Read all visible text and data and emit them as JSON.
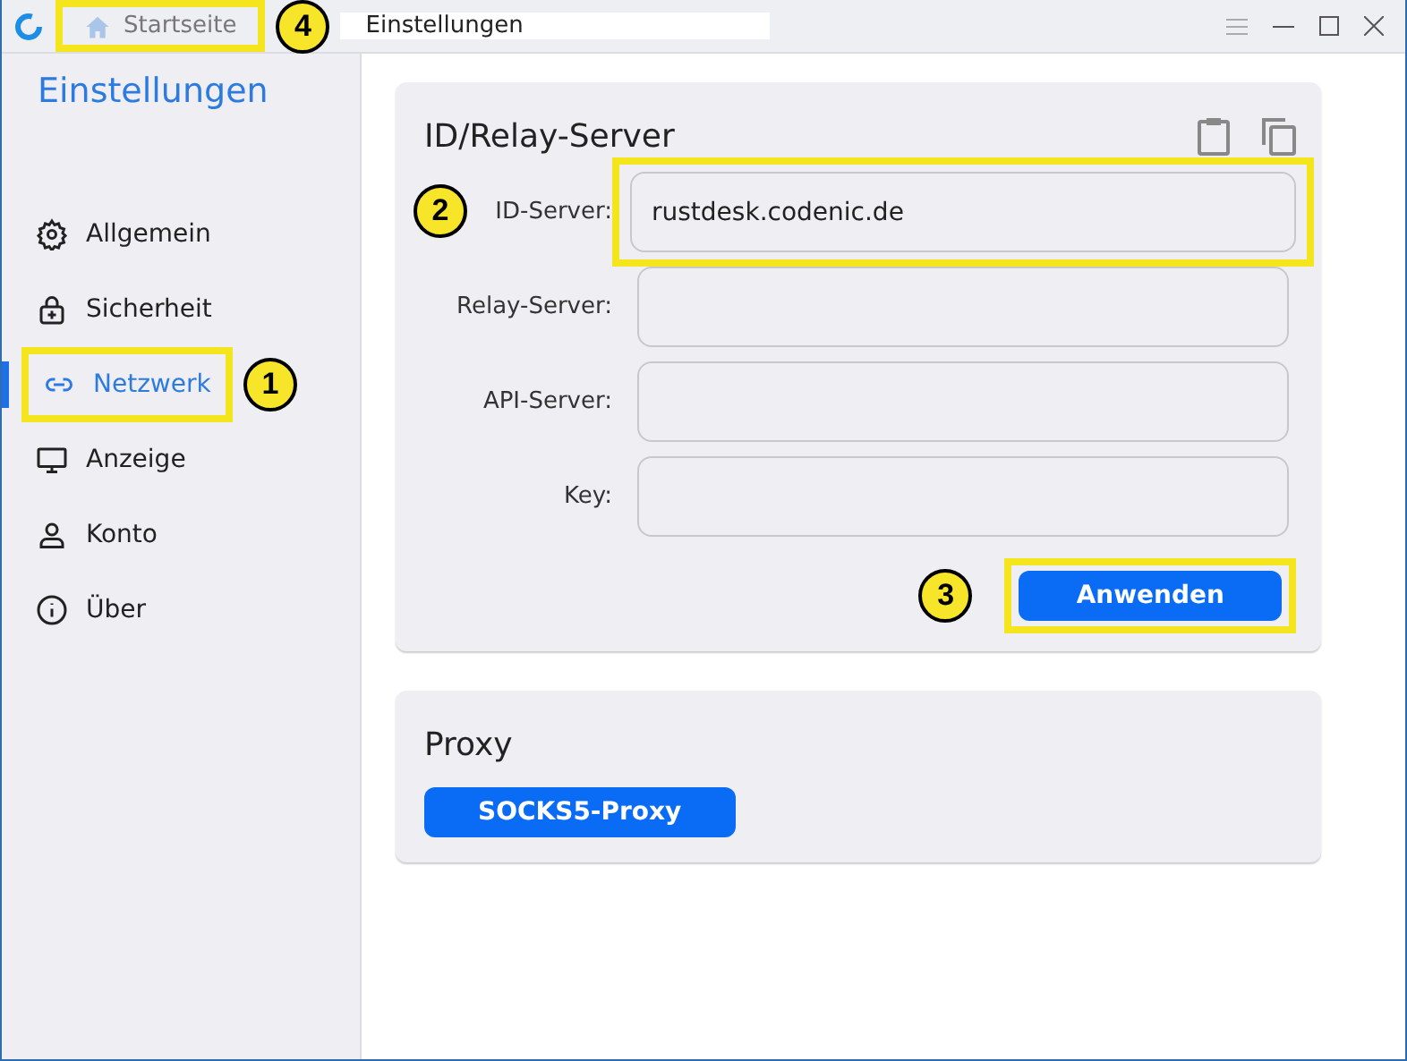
{
  "titlebar": {
    "tabs": [
      {
        "label": "Startseite",
        "kind": "home",
        "selected": false,
        "highlighted": true,
        "callout": "4"
      },
      {
        "label": "Einstellungen",
        "kind": "page",
        "selected": true,
        "highlighted": false
      }
    ]
  },
  "sidebar": {
    "title": "Einstellungen",
    "items": [
      {
        "label": "Allgemein",
        "selected": false,
        "highlighted": false
      },
      {
        "label": "Sicherheit",
        "selected": false,
        "highlighted": false
      },
      {
        "label": "Netzwerk",
        "selected": true,
        "highlighted": true,
        "callout": "1"
      },
      {
        "label": "Anzeige",
        "selected": false,
        "highlighted": false
      },
      {
        "label": "Konto",
        "selected": false,
        "highlighted": false
      },
      {
        "label": "Über",
        "selected": false,
        "highlighted": false
      }
    ]
  },
  "server_card": {
    "title": "ID/Relay-Server",
    "fields": [
      {
        "label": "ID-Server:",
        "value": "rustdesk.codenic.de",
        "highlighted": true,
        "callout": "2"
      },
      {
        "label": "Relay-Server:",
        "highlighted": false
      },
      {
        "label": "API-Server:",
        "highlighted": false
      },
      {
        "label": "Key:",
        "highlighted": false
      }
    ],
    "apply_button": {
      "label": "Anwenden",
      "highlighted": true,
      "callout": "3"
    }
  },
  "proxy_card": {
    "title": "Proxy",
    "button": {
      "label": "SOCKS5-Proxy"
    }
  }
}
